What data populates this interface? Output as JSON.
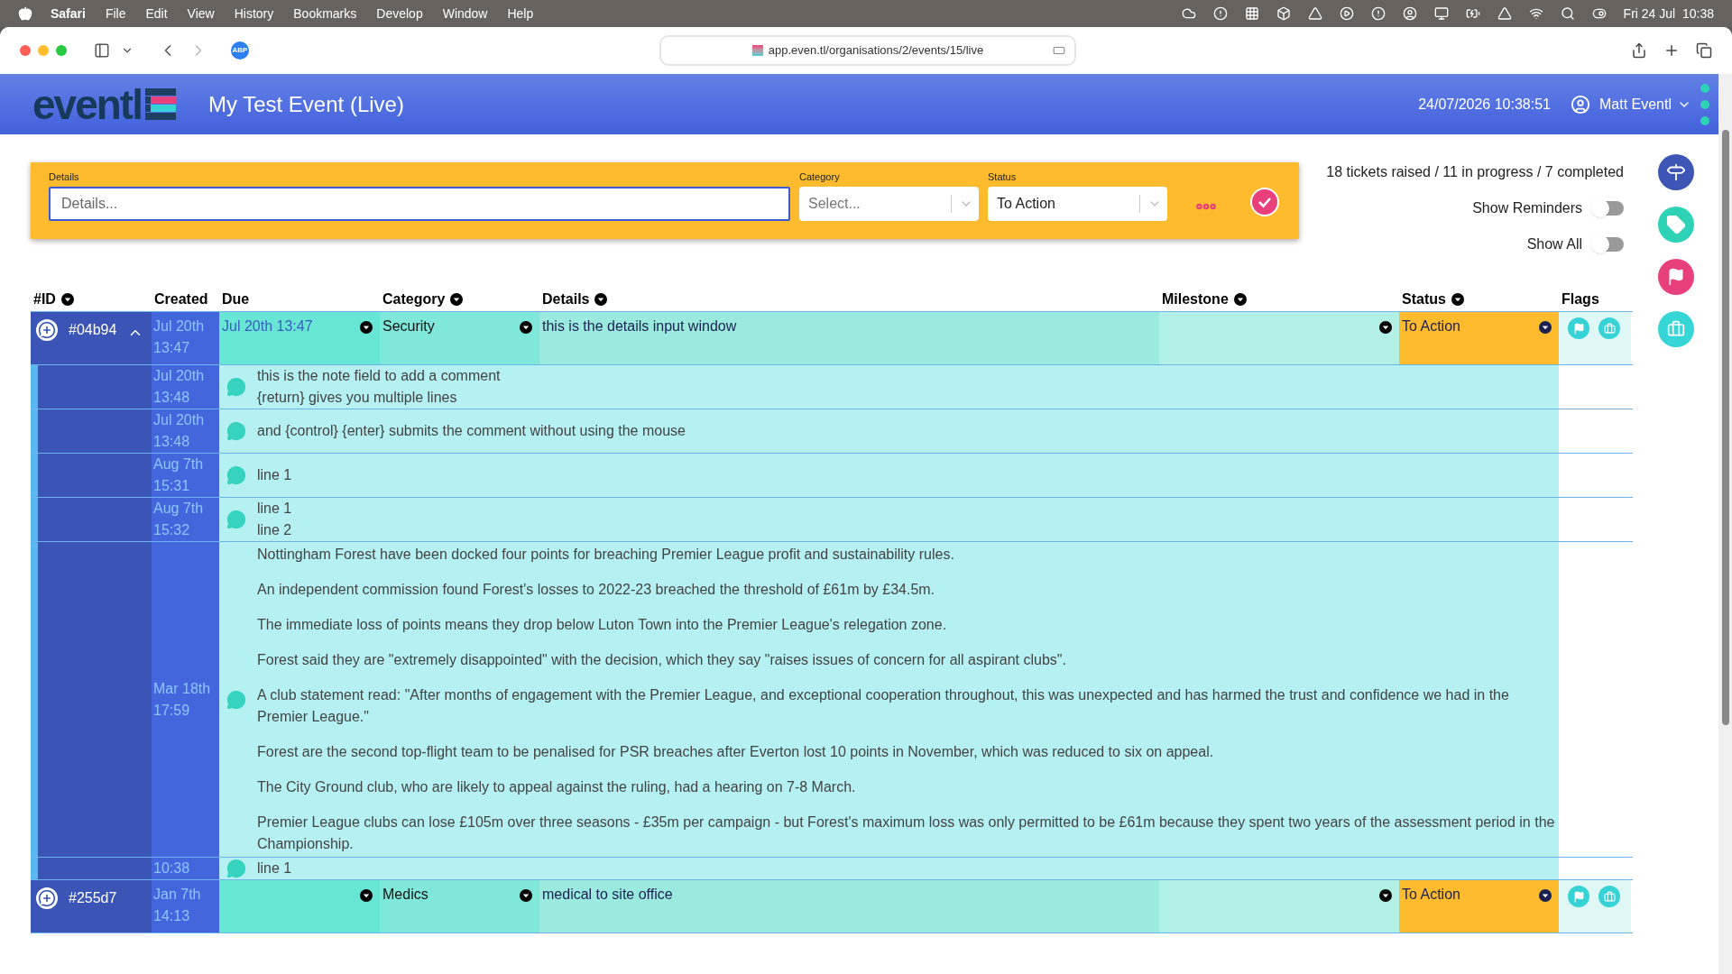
{
  "menubar": {
    "app": "Safari",
    "menus": [
      "File",
      "Edit",
      "View",
      "History",
      "Bookmarks",
      "Develop",
      "Window",
      "Help"
    ],
    "clock": "Fri 24 Jul  10:38"
  },
  "browser": {
    "extension": "ABP",
    "url": "app.even.tl/organisations/2/events/15/live"
  },
  "header": {
    "logo": "eventl",
    "title": "My Test Event (Live)",
    "datetime": "24/07/2026 10:38:51",
    "user": "Matt Eventl"
  },
  "filter": {
    "details_label": "Details",
    "details_placeholder": "Details...",
    "category_label": "Category",
    "category_placeholder": "Select...",
    "status_label": "Status",
    "status_value": "To Action"
  },
  "summary": "18 tickets raised / 11 in progress / 7 completed",
  "toggles": [
    {
      "label": "Show Reminders",
      "on": false
    },
    {
      "label": "Show All",
      "on": false
    }
  ],
  "table": {
    "columns": [
      {
        "label": "#ID",
        "sortable": true
      },
      {
        "label": "Created",
        "sortable": false
      },
      {
        "label": "Due",
        "sortable": false
      },
      {
        "label": "Category",
        "sortable": true
      },
      {
        "label": "Details",
        "sortable": true
      },
      {
        "label": "Milestone",
        "sortable": true
      },
      {
        "label": "Status",
        "sortable": true
      },
      {
        "label": "Flags",
        "sortable": false
      }
    ],
    "rows": [
      {
        "id": "#04b94",
        "expanded": true,
        "created": "Jul 20th 13:47",
        "due": "Jul 20th 13:47",
        "category": "Security",
        "details": "this is the details input window",
        "status": "To Action",
        "comments": [
          {
            "created": "Jul 20th 13:48",
            "paragraphs": [
              "this is the note field to add a comment",
              "{return} gives you multiple lines"
            ]
          },
          {
            "created": "Jul 20th 13:48",
            "paragraphs": [
              "and {control} {enter} submits the comment without using the mouse"
            ]
          },
          {
            "created": "Aug 7th 15:31",
            "paragraphs": [
              "line 1"
            ]
          },
          {
            "created": "Aug 7th 15:32",
            "paragraphs": [
              "line 1",
              "line 2"
            ]
          },
          {
            "created": "Mar 18th 17:59",
            "spaced": true,
            "paragraphs": [
              "Nottingham Forest have been docked four points for breaching Premier League profit and sustainability rules.",
              "An independent commission found Forest's losses to 2022-23 breached the threshold of £61m by £34.5m.",
              "The immediate loss of points means they drop below Luton Town into the Premier League's relegation zone.",
              "Forest said they are \"extremely disappointed\" with the decision, which they say \"raises issues of concern for all aspirant clubs\".",
              "A club statement read: \"After months of engagement with the Premier League, and exceptional cooperation throughout, this was unexpected and has harmed the trust and confidence we had in the Premier League.\"",
              "Forest are the second top-flight team to be penalised for PSR breaches after Everton lost 10 points in November, which was reduced to six on appeal.",
              "The City Ground club, who are likely to appeal against the ruling, had a hearing on 7-8 March.",
              "Premier League clubs can lose £105m over three seasons - £35m per campaign - but Forest's maximum loss was only permitted to be £61m because they spent two years of the assessment period in the Championship."
            ]
          },
          {
            "created": "10:38",
            "paragraphs": [
              "line 1"
            ]
          }
        ]
      },
      {
        "id": "#255d7",
        "expanded": false,
        "created": "Jan 7th 14:13",
        "category": "Medics",
        "details": "medical to site office",
        "status": "To Action",
        "comments": []
      }
    ]
  }
}
